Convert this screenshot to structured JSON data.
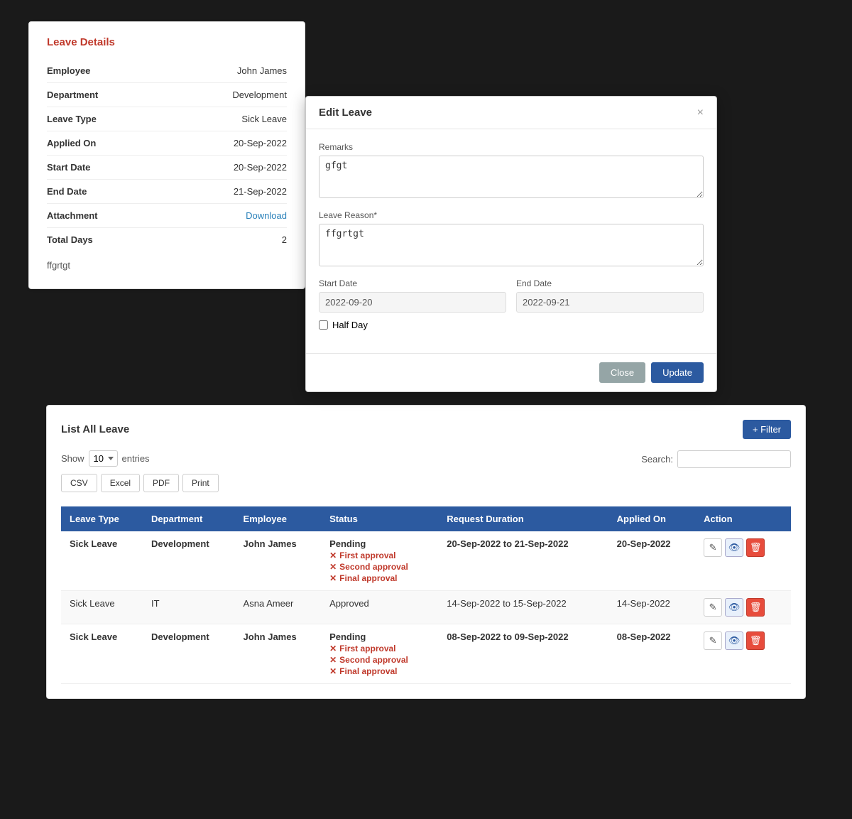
{
  "leaveDetails": {
    "title": "Leave Details",
    "fields": [
      {
        "label": "Employee",
        "value": "John James",
        "type": "normal"
      },
      {
        "label": "Department",
        "value": "Development",
        "type": "normal"
      },
      {
        "label": "Leave Type",
        "value": "Sick Leave",
        "type": "normal"
      },
      {
        "label": "Applied On",
        "value": "20-Sep-2022",
        "type": "normal"
      },
      {
        "label": "Start Date",
        "value": "20-Sep-2022",
        "type": "normal"
      },
      {
        "label": "End Date",
        "value": "21-Sep-2022",
        "type": "normal"
      },
      {
        "label": "Attachment",
        "value": "Download",
        "type": "link"
      },
      {
        "label": "Total Days",
        "value": "2",
        "type": "normal"
      }
    ],
    "remarks": "ffgrtgt"
  },
  "editLeave": {
    "title": "Edit Leave",
    "remarksLabel": "Remarks",
    "remarksValue": "gfgt",
    "leaveReasonLabel": "Leave Reason*",
    "leaveReasonValue": "ffgrtgt",
    "startDateLabel": "Start Date",
    "startDateValue": "2022-09-20",
    "endDateLabel": "End Date",
    "endDateValue": "2022-09-21",
    "halfDayLabel": "Half Day",
    "closeBtn": "Close",
    "updateBtn": "Update"
  },
  "listLeave": {
    "titlePrefix": "List All",
    "titleBold": "Leave",
    "filterBtn": "+ Filter",
    "showLabel": "Show",
    "showValue": "10",
    "entriesLabel": "entries",
    "exportBtns": [
      "CSV",
      "Excel",
      "PDF",
      "Print"
    ],
    "searchLabel": "Search:",
    "searchPlaceholder": "",
    "columns": [
      "Leave Type",
      "Department",
      "Employee",
      "Status",
      "Request Duration",
      "Applied On",
      "Action"
    ],
    "rows": [
      {
        "leaveType": "Sick Leave",
        "department": "Development",
        "employee": "John James",
        "statusMain": "Pending",
        "approvals": [
          "First approval",
          "Second approval",
          "Final approval"
        ],
        "duration": "20-Sep-2022 to 21-Sep-2022",
        "appliedOn": "20-Sep-2022",
        "bold": true
      },
      {
        "leaveType": "Sick Leave",
        "department": "IT",
        "employee": "Asna Ameer",
        "statusMain": "Approved",
        "approvals": [],
        "duration": "14-Sep-2022 to 15-Sep-2022",
        "appliedOn": "14-Sep-2022",
        "bold": false
      },
      {
        "leaveType": "Sick Leave",
        "department": "Development",
        "employee": "John James",
        "statusMain": "Pending",
        "approvals": [
          "First approval",
          "Second approval",
          "Final approval"
        ],
        "duration": "08-Sep-2022 to 09-Sep-2022",
        "appliedOn": "08-Sep-2022",
        "bold": true
      }
    ]
  }
}
